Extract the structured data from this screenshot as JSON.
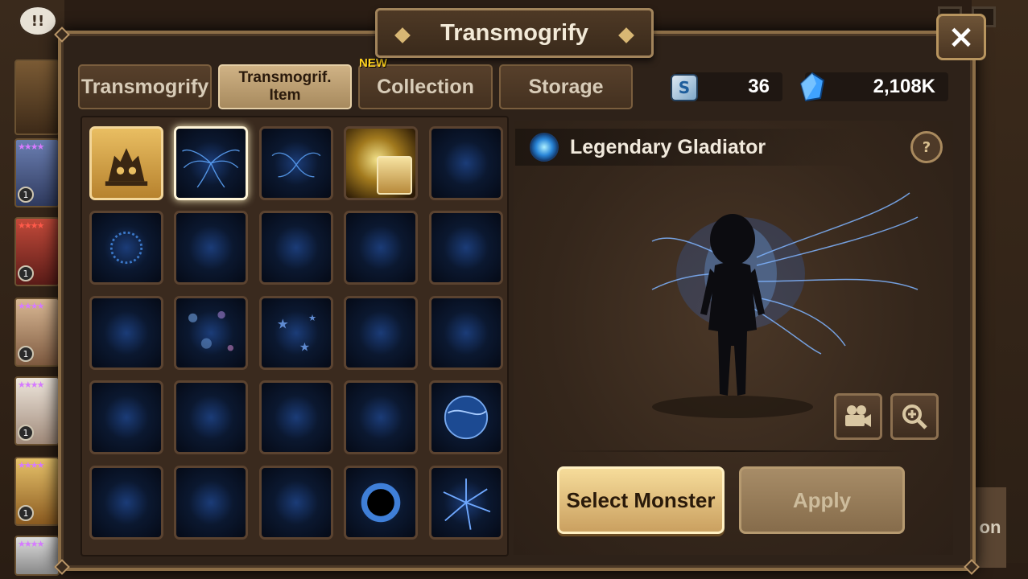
{
  "window": {
    "title": "Transmogrify"
  },
  "tabs": [
    {
      "label": "Transmogrify",
      "active": false
    },
    {
      "label": "Transmogrif.\nItem",
      "active": true
    },
    {
      "label": "Collection",
      "active": false,
      "badge": "NEW"
    },
    {
      "label": "Storage",
      "active": false
    }
  ],
  "currency": {
    "tickets": "36",
    "crystals": "2,108K"
  },
  "selected_item": {
    "name": "Legendary Gladiator"
  },
  "buttons": {
    "close": "×",
    "help": "?",
    "select_monster": "Select Monster",
    "apply": "Apply"
  },
  "side_list": [
    {
      "level": "1"
    },
    {
      "level": "1"
    },
    {
      "level": "1"
    },
    {
      "level": "1"
    },
    {
      "level": "1"
    }
  ],
  "background": {
    "partial_label": "on"
  },
  "colors": {
    "accent_gold": "#d8b774",
    "effect_blue": "#2a86d8",
    "panel_brown": "#2e2219"
  }
}
